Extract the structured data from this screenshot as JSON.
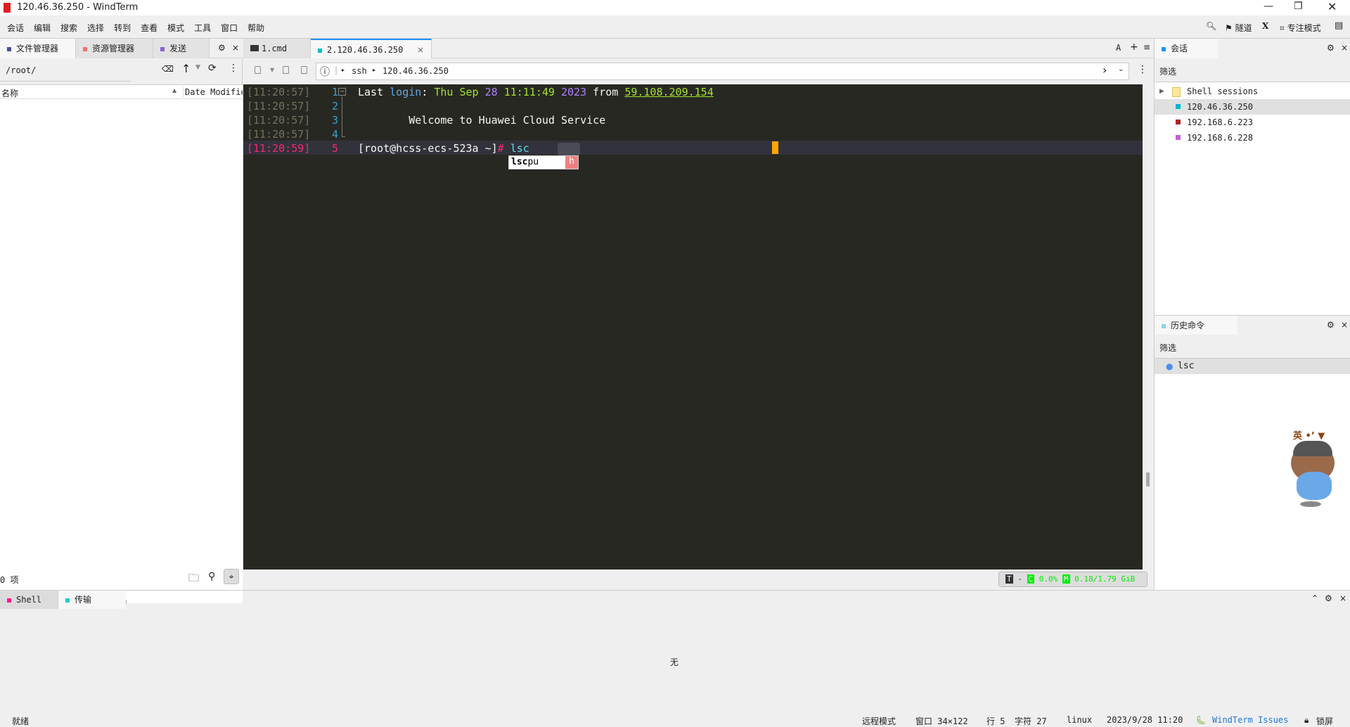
{
  "window": {
    "title": "120.46.36.250 - WindTerm"
  },
  "menu": [
    "会话",
    "编辑",
    "搜索",
    "选择",
    "转到",
    "查看",
    "模式",
    "工具",
    "窗口",
    "帮助"
  ],
  "toolbar_right": {
    "tunnel": "隧道",
    "x": "X",
    "focus_mode": "专注模式"
  },
  "left_panel": {
    "tabs": [
      {
        "label": "文件管理器",
        "color": "#4a4fa0"
      },
      {
        "label": "资源管理器",
        "color": "#f07070"
      },
      {
        "label": "发送",
        "color": "#8a60d0"
      }
    ],
    "path": "/root/",
    "columns": [
      "名称",
      "Date Modified"
    ],
    "count": "0 项"
  },
  "terminal_tabs": [
    {
      "label": "1.cmd"
    },
    {
      "label": "2.120.46.36.250",
      "color": "#00bcd4"
    }
  ],
  "terminal_tabs_right": {
    "font": "A",
    "add": "+",
    "menu": "≡"
  },
  "address": {
    "protocol": "ssh",
    "host": "120.46.36.250"
  },
  "terminal": {
    "lines": [
      {
        "time": "[11:20:57]",
        "num": "1",
        "segs": [
          [
            "Last ",
            "#f8f8f2"
          ],
          [
            "login",
            "#66a8e0"
          ],
          [
            ": ",
            "#f8f8f2"
          ],
          [
            "Thu Sep ",
            "#a6e22e"
          ],
          [
            "28 ",
            "#ae81ff"
          ],
          [
            "11:11:49 ",
            "#a6e22e"
          ],
          [
            "2023",
            "#ae81ff"
          ],
          [
            " from ",
            "#f8f8f2"
          ],
          [
            "59.108.209.154",
            "#a6e22e"
          ]
        ]
      },
      {
        "time": "[11:20:57]",
        "num": "2",
        "segs": []
      },
      {
        "time": "[11:20:57]",
        "num": "3",
        "segs": [
          [
            "        Welcome to Huawei Cloud Service",
            "#f8f8f2"
          ]
        ]
      },
      {
        "time": "[11:20:57]",
        "num": "4",
        "segs": []
      },
      {
        "time": "[11:20:59]",
        "num": "5",
        "segs": [
          [
            "[root@hcss-ecs-523a ~]",
            "#f8f8f2"
          ],
          [
            "# ",
            "#f92672"
          ],
          [
            "lsc",
            "#66d9ef"
          ]
        ]
      }
    ],
    "completion": {
      "text": "lscpu",
      "match": "lsc",
      "tag": "h"
    }
  },
  "monitor": {
    "t": "T",
    "dash": "-",
    "c": "C",
    "cpu": "0.0%",
    "m": "M",
    "mem": "0.18/1.79 GiB"
  },
  "sessions": {
    "title": "会话",
    "filter": "筛选",
    "items": [
      {
        "label": "Shell sessions",
        "type": "folder"
      },
      {
        "label": "120.46.36.250",
        "color": "#00b4d0"
      },
      {
        "label": "192.168.6.223",
        "color": "#b22222"
      },
      {
        "label": "192.168.6.228",
        "color": "#c060d8"
      }
    ]
  },
  "history": {
    "title": "历史命令",
    "filter": "筛选",
    "items": [
      "lsc"
    ]
  },
  "bottom_panel": {
    "tabs": [
      {
        "label": "Shell",
        "color": "#ff1a8c"
      },
      {
        "label": "传输",
        "color": "#20c8d8"
      }
    ],
    "empty": "无"
  },
  "statusbar": {
    "ready": "就绪",
    "mode": "远程模式",
    "window": "窗口 34×122",
    "row": "行 5",
    "col": "字符 27",
    "os": "linux",
    "datetime": "2023/9/28 11:20",
    "issues": "WindTerm Issues",
    "lock": "锁屏"
  }
}
